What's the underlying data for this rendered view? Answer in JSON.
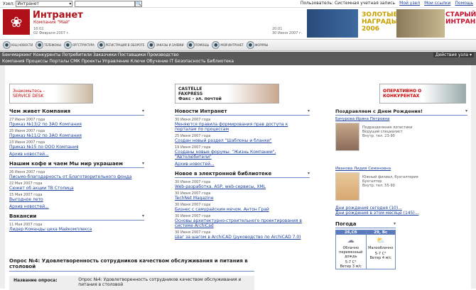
{
  "topbar": {
    "node_label": "Узел:",
    "node_value": "Интранет",
    "search_placeholder": "",
    "search_btn": "🔍",
    "user": "Пользователь: Системная учетная запись",
    "my_node": "Мой узел",
    "my_links": "Мои ссылки",
    "help": "Помощь"
  },
  "header": {
    "title": "Интранет",
    "subtitle": "Компания \"Май\"",
    "time1": "16:02",
    "date1": "02 Февраля 2007 г.",
    "time2": "20:01",
    "date2": "30 Июня 2007 г.",
    "ad1": "ЗОЛОТЫЕ НАГРАДЫ 2006",
    "ad2": "СТАРЫЙ ИНТРАНЕТ"
  },
  "toolbar": [
    {
      "label": "ЮЩ НОВОСТИ",
      "icon": "news-icon"
    },
    {
      "label": "ТЕЛЕФОНЫ",
      "icon": "phone-icon"
    },
    {
      "label": "ОРГСТРУКТУРА",
      "icon": "org-icon"
    },
    {
      "label": "РЕГИСТРАЦИЯ В ОБОРОТЕ",
      "icon": "register-icon"
    },
    {
      "label": "ЗАКАЗЫ И ЗАЯВКИ",
      "icon": "orders-icon"
    },
    {
      "label": "ПОМОЩЬ",
      "icon": "help-icon"
    },
    {
      "label": "МОЙ ИНТРАНЕТ",
      "icon": "my-intranet-icon"
    },
    {
      "label": "ФОРУМЫ",
      "icon": "forum-icon"
    }
  ],
  "nav": {
    "row1": "Бенчмаркинг  Конкуренты  Потребители  Заказчики  Поставщики  Производство",
    "row2": "Компания  Процессы  Порталы  СМК  Проекты  Управление  Ключи  Обучение  IT  Безопасность  Библиотека",
    "actions": "Действия узла ▾"
  },
  "banners": {
    "b1": "Знакомьтесь -\nSERVICE DESK",
    "b2": "CASTELLE\nFAXPRESS\nФакс - эл. почтой",
    "b3": "ОПЕРАТИВНО О\nКОНКУРЕНТАХ"
  },
  "company": {
    "heading": "Чем живет Компания",
    "items": [
      {
        "date": "27 Июня 2007 года",
        "title": "Приказ №13/2 по ЗАО Компания"
      },
      {
        "date": "25 Июня 2007 года",
        "title": "Приказ №11/2 по ЗАО Компания"
      },
      {
        "date": "23 Июня 2007 года",
        "title": "Приказ №15 по ООО Компания"
      }
    ],
    "archive": "Архив новостей..."
  },
  "coffee": {
    "heading": "Нашим кофе и чаем Мы мир украшаем",
    "items": [
      {
        "date": "26 Июня 2007 года",
        "title": "Письмо-благодарность от Благотворительного фонда"
      },
      {
        "date": "22 Мая 2007 года",
        "title": "Сюжет об акции ТВ Столица"
      },
      {
        "date": "15 Мая 2007 года",
        "title": "Выгодное лето"
      }
    ],
    "archive": "Архив новостей..."
  },
  "vacancies": {
    "heading": "Вакансии",
    "items": [
      {
        "date": "11 Мая 2007 года",
        "title": "Лидер Команды цеха Майкомплекса"
      }
    ]
  },
  "intranet_news": {
    "heading": "Новости Интранет",
    "items": [
      {
        "date": "30 Июня 2007 года",
        "title": "Меняются правила формирования прав доступа к порталам по процессам"
      },
      {
        "date": "25 Июня 2007 года",
        "title": "Создан новый раздел \"Шаблоны и бланки\""
      },
      {
        "date": "19 Июня 2007 года",
        "title": "Созданы новые форумы: \"Жизнь Компании\", \"Автолюбители\""
      }
    ],
    "archive": "Архив новостей..."
  },
  "library": {
    "heading": "Новое в электронной библиотеке",
    "items": [
      {
        "date": "30 Июня 2007 года",
        "title": "Web-разработка. ASP, web-сервисы, XML"
      },
      {
        "date": "30 Июня 2007 года",
        "title": "TechNet Magazine"
      },
      {
        "date": "30 Июня 2007 года",
        "title": "Бизнес с самурайским мечом. Антон Грай"
      },
      {
        "date": "30 Июня 2007 года",
        "title": "Основы архитектурно-строительного проектирования в системе ArchiCad"
      },
      {
        "date": "30 Июня 2007 года",
        "title": "Шаг за шагом в ArchiCAD (руководство по ArchiCAD 7.0)"
      }
    ]
  },
  "birthday": {
    "heading": "Поздравляем с Днем Рождения!",
    "people": [
      {
        "name": "Бачурова Ирина Петровна",
        "info": "Подразделение логистики\nВедущий специалист\nВнутр. тел. 23-90"
      },
      {
        "name": "Иванова Лидия Семеновна",
        "info": "Южный филиал, бухгалтерия\nБухгалтер\nВнутр. тел. 55-90"
      }
    ],
    "today": "Дни рождения сегодня (10)...",
    "week": "Дни рождения в этом месяце (145)..."
  },
  "weather": {
    "heading": "Погода",
    "days": [
      {
        "temp": "26,Сб",
        "desc": "Облачно переменный дождь",
        "wind": "5-7 С°\nВетер 3 м/с"
      },
      {
        "temp": "29, Вс",
        "desc": "Малооблачно",
        "wind": "5-7 С°\nВетер 4 м/с"
      }
    ]
  },
  "poll": {
    "title": "Опрос №4: Удовлетворенность сотрудников качеством обслуживания и питания в столовой",
    "label": "Название опроса:",
    "value": "Опрос №4: Удовлетворенность сотрудников качеством обслуживания и питания в столовой"
  }
}
